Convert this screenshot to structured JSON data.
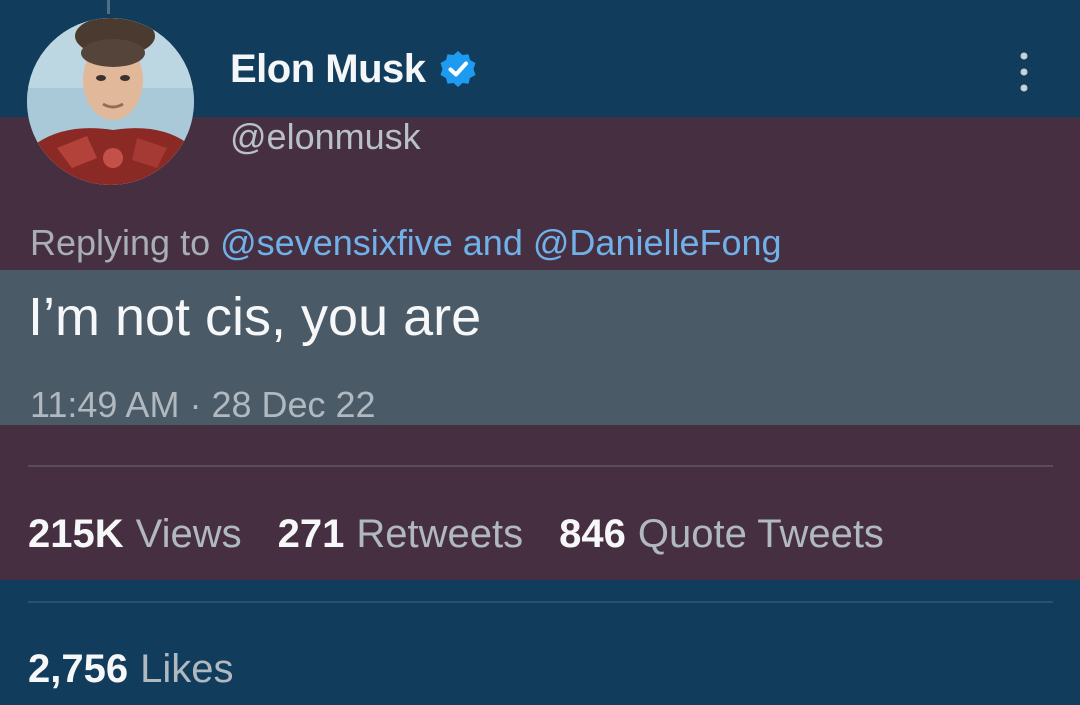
{
  "tweet": {
    "author": {
      "display_name": "Elon Musk",
      "handle": "@elonmusk",
      "verified": true
    },
    "replying_to": {
      "prefix": "Replying to",
      "mentions": [
        "@sevensixfive",
        "@DanielleFong"
      ],
      "joiner": "and"
    },
    "text": "I’m not cis, you are",
    "time": "11:49 AM",
    "separator": "·",
    "date": "28 Dec 22",
    "stats": [
      {
        "count": "215K",
        "label": "Views"
      },
      {
        "count": "271",
        "label": "Retweets"
      },
      {
        "count": "846",
        "label": "Quote Tweets"
      }
    ],
    "likes": {
      "count": "2,756",
      "label": "Likes"
    }
  },
  "icons": {
    "verified": "verified-badge-icon",
    "more": "more-vertical-icon",
    "avatar": "avatar"
  },
  "colors": {
    "verified_blue": "#1d9bf0",
    "mention_blue": "#6fb1e8"
  }
}
